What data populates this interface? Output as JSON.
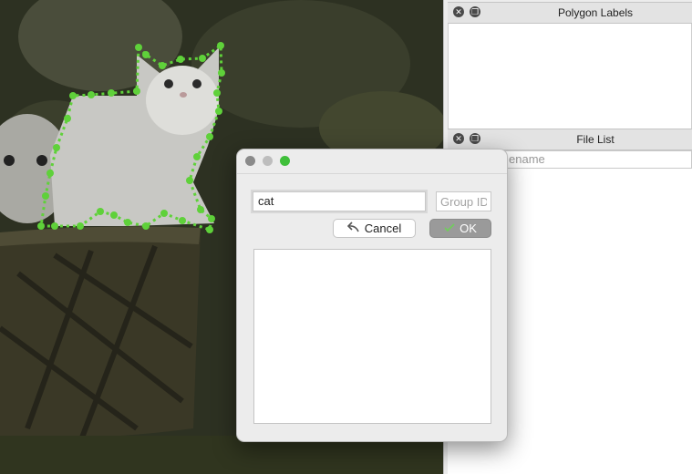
{
  "dock": {
    "polygon_labels": {
      "title": "Polygon Labels"
    },
    "file_list": {
      "title": "File List",
      "search_placeholder": "Filename",
      "search_visible_text": "ename"
    }
  },
  "dialog": {
    "label_value": "cat",
    "group_id_placeholder": "Group ID",
    "cancel_label": "Cancel",
    "ok_label": "OK"
  },
  "icons": {
    "dock_close": "close-icon",
    "dock_float": "float-icon",
    "cancel": "undo-arrow-icon",
    "ok": "checkmark-icon"
  },
  "colors": {
    "polygon_point": "#5fd13a",
    "zoom_button": "#3fbf3a",
    "ok_button": "#9a9a9a"
  }
}
